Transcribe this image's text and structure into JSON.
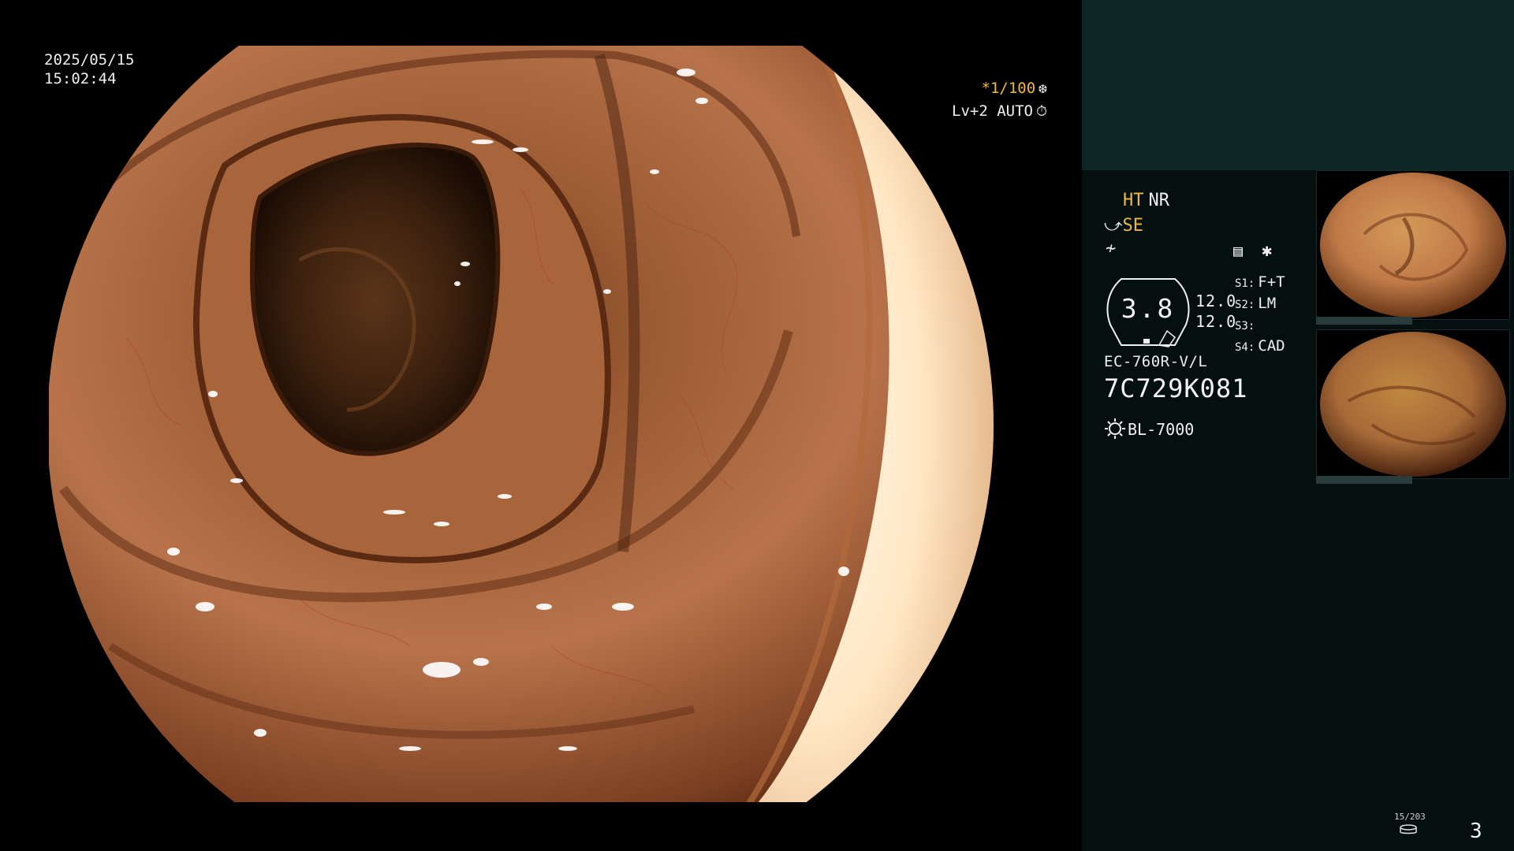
{
  "overlay": {
    "date": "2025/05/15",
    "time": "15:02:44",
    "zoom": "*1/100",
    "level": "Lv+2 AUTO"
  },
  "panel": {
    "ht": "HT",
    "nr": "NR",
    "se": "SE",
    "gauge_value": "3.8",
    "gauge_num1": "12.0",
    "gauge_num2": "12.0",
    "s_settings": [
      {
        "key": "S1:",
        "value": "F+T"
      },
      {
        "key": "S2:",
        "value": "LM"
      },
      {
        "key": "S3:",
        "value": ""
      },
      {
        "key": "S4:",
        "value": "CAD"
      }
    ],
    "model": "EC-760R-V/L",
    "serial": "7C729K081",
    "light_source": "BL-7000"
  },
  "footer": {
    "counter": "15/203",
    "page": "3"
  },
  "colors": {
    "accent_yellow": "#f0b840",
    "panel_bg": "#04100f",
    "panel_top": "#0b2624"
  },
  "icons": [
    "snowflake-icon",
    "timer-icon",
    "structure-enhance-icon",
    "freeze-icon",
    "image-mode-icon",
    "asterisk-icon",
    "light-source-icon",
    "storage-disk-icon"
  ]
}
